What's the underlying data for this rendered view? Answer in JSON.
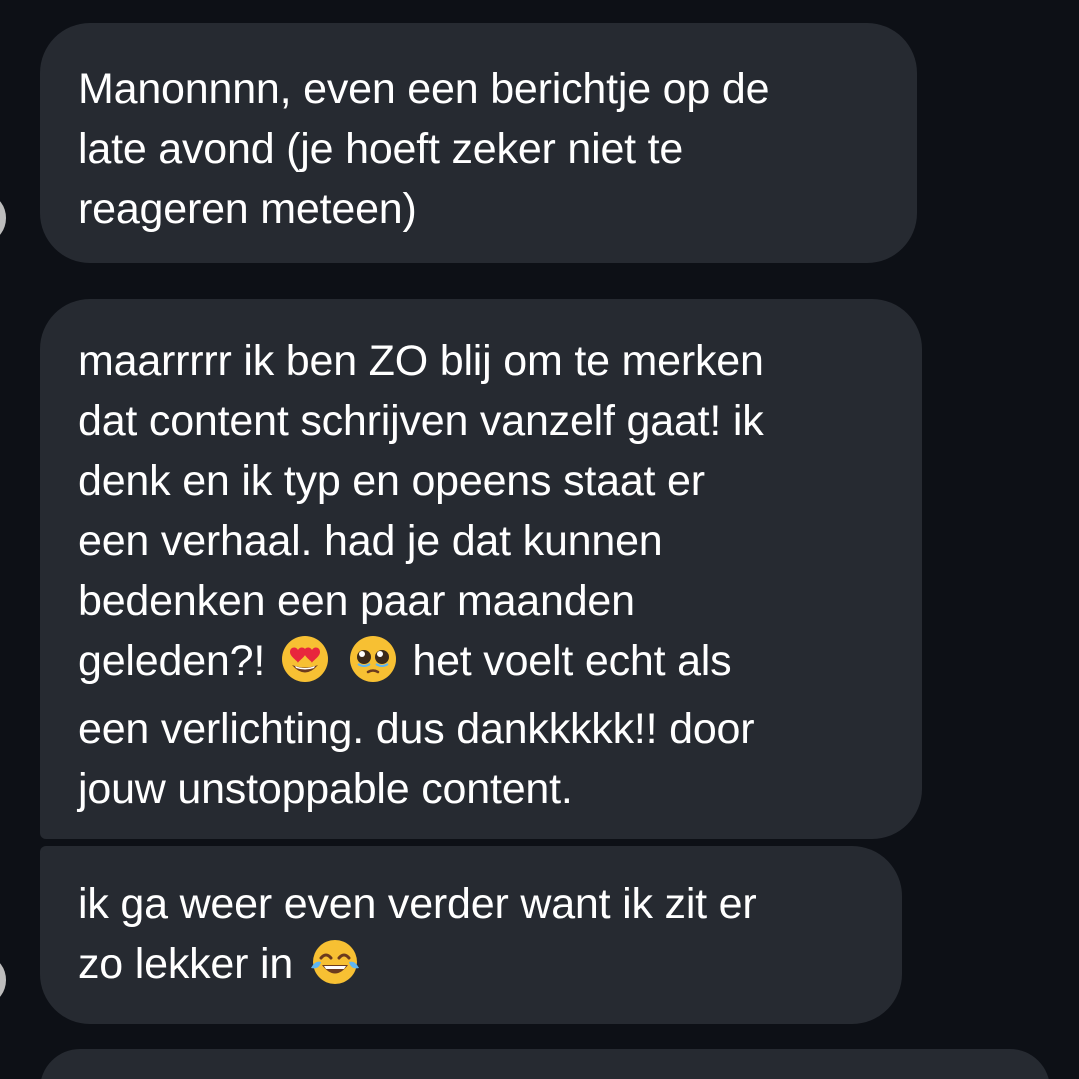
{
  "messages": [
    {
      "lines": [
        "Manonnnn, even een berichtje op de",
        "late avond (je hoeft zeker niet te",
        "reageren meteen)"
      ]
    },
    {
      "lines": [
        "maarrrrr ik ben ZO blij om te merken",
        "dat content schrijven vanzelf gaat! ik",
        "denk en ik typ en opeens staat er",
        "een verhaal. had je dat kunnen",
        "bedenken een paar maanden"
      ],
      "emoji_line": {
        "before": "geleden?!",
        "emojis": [
          "heart-eyes-emoji",
          "pleading-face-emoji"
        ],
        "after": "het voelt echt als"
      },
      "lines_after": [
        "een verlichting. dus dankkkkk!! door",
        "jouw unstoppable content."
      ]
    },
    {
      "lines": [
        "ik ga weer even verder want ik zit er"
      ],
      "emoji_line": {
        "before": "zo lekker in",
        "emojis": [
          "tears-of-joy-emoji"
        ]
      }
    }
  ],
  "colors": {
    "background": "#0d1016",
    "bubble": "#262a31",
    "text": "#ffffff",
    "emoji_yellow": "#f7c033",
    "heart_red": "#e8263d",
    "tear_blue": "#5fb6f2"
  }
}
